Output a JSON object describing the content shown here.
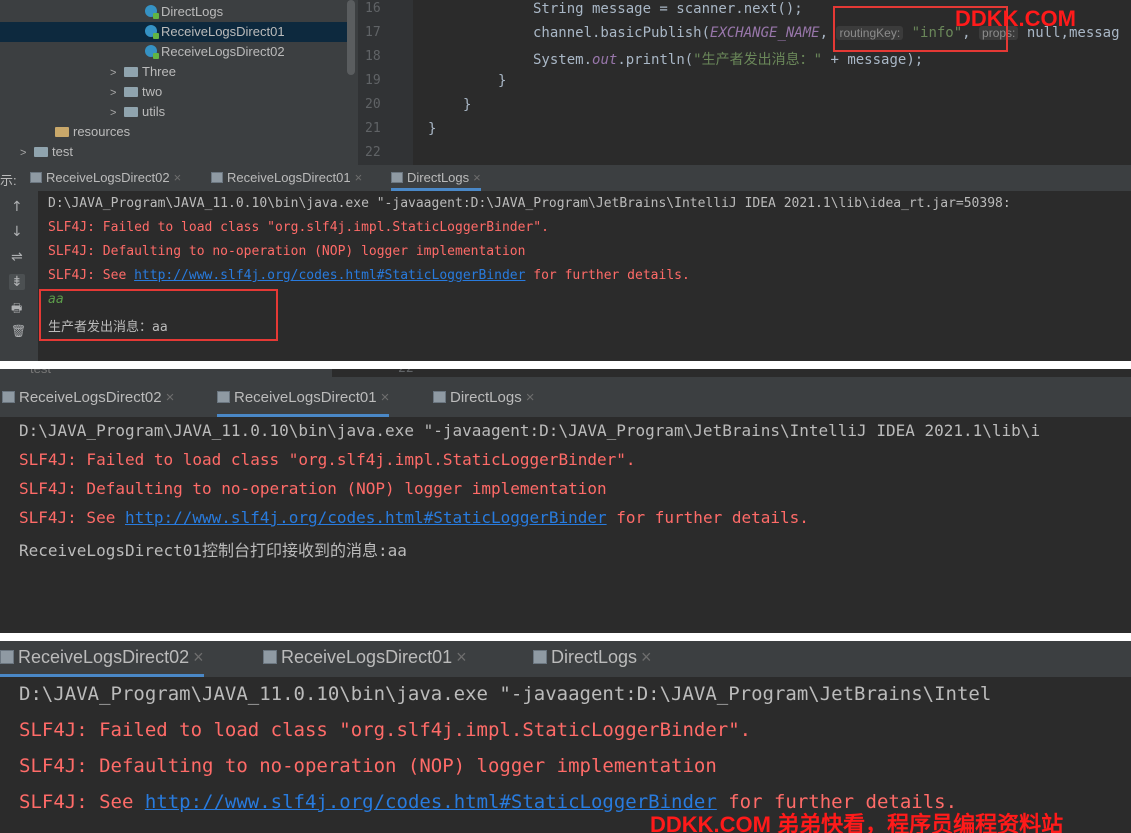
{
  "panel1": {
    "tree": {
      "items": [
        {
          "label": "DirectLogs"
        },
        {
          "label": "ReceiveLogsDirect01"
        },
        {
          "label": "ReceiveLogsDirect02"
        },
        {
          "label": "Three"
        },
        {
          "label": "two"
        },
        {
          "label": "utils"
        },
        {
          "label": "resources"
        },
        {
          "label": "test"
        }
      ]
    },
    "editor": {
      "line_numbers": [
        "16",
        "17",
        "18",
        "19",
        "20",
        "21",
        "22"
      ],
      "line16": "String message = scanner.next();",
      "line17_a": "channel.basicPublish(",
      "line17_const": "EXCHANGE_NAME",
      "line17_b": ", ",
      "line17_hint1": "routingKey:",
      "line17_str": "\"info\"",
      "line17_c": ", ",
      "line17_hint2": "props:",
      "line17_d": " null,messag",
      "line18_a": "System.",
      "line18_out": "out",
      "line18_b": ".println(",
      "line18_str": "\"生产者发出消息：\"",
      "line18_c": " + message);",
      "line19": "}",
      "line20": "}",
      "line21": "}"
    },
    "run_label": "示:",
    "tabs": [
      {
        "label": "ReceiveLogsDirect02"
      },
      {
        "label": "ReceiveLogsDirect01"
      },
      {
        "label": "DirectLogs"
      }
    ],
    "console": {
      "cmd": "D:\\JAVA_Program\\JAVA_11.0.10\\bin\\java.exe \"-javaagent:D:\\JAVA_Program\\JetBrains\\IntelliJ IDEA 2021.1\\lib\\idea_rt.jar=50398:",
      "err1": "SLF4J: Failed to load class \"org.slf4j.impl.StaticLoggerBinder\".",
      "err2": "SLF4J: Defaulting to no-operation (NOP) logger implementation",
      "err3_pre": "SLF4J: See ",
      "err3_link": "http://www.slf4j.org/codes.html#StaticLoggerBinder",
      "err3_post": " for further details.",
      "input": "aa",
      "output": "生产者发出消息：aa"
    },
    "tools": [
      "↑",
      "↓",
      "⇌",
      "⇟",
      "🖶",
      "🗑"
    ]
  },
  "panel2": {
    "strip_text": "test",
    "strip_num": "22",
    "tabs": [
      {
        "label": "ReceiveLogsDirect02"
      },
      {
        "label": "ReceiveLogsDirect01"
      },
      {
        "label": "DirectLogs"
      }
    ],
    "console": {
      "cmd": "D:\\JAVA_Program\\JAVA_11.0.10\\bin\\java.exe \"-javaagent:D:\\JAVA_Program\\JetBrains\\IntelliJ IDEA 2021.1\\lib\\i",
      "err1": "SLF4J: Failed to load class \"org.slf4j.impl.StaticLoggerBinder\".",
      "err2": "SLF4J: Defaulting to no-operation (NOP) logger implementation",
      "err3_pre": "SLF4J: See ",
      "err3_link": "http://www.slf4j.org/codes.html#StaticLoggerBinder",
      "err3_post": " for further details.",
      "output": "ReceiveLogsDirect01控制台打印接收到的消息:aa"
    }
  },
  "panel3": {
    "tabs": [
      {
        "label": "ReceiveLogsDirect02"
      },
      {
        "label": "ReceiveLogsDirect01"
      },
      {
        "label": "DirectLogs"
      }
    ],
    "console": {
      "cmd": "D:\\JAVA_Program\\JAVA_11.0.10\\bin\\java.exe \"-javaagent:D:\\JAVA_Program\\JetBrains\\Intel",
      "err1": "SLF4J: Failed to load class \"org.slf4j.impl.StaticLoggerBinder\".",
      "err2": "SLF4J: Defaulting to no-operation (NOP) logger implementation",
      "err3_pre": "SLF4J: See ",
      "err3_link": "http://www.slf4j.org/codes.html#StaticLoggerBinder",
      "err3_post": " for further details."
    }
  },
  "watermark": {
    "top": "DDKK.COM",
    "bottom": "DDKK.COM 弟弟快看，程序员编程资料站"
  },
  "colors": {
    "editor_bg": "#2b2b2b",
    "panel_bg": "#3c3f41",
    "error_red": "#ff6b68",
    "link_blue": "#287bde",
    "highlight_box": "#e53935",
    "watermark_red": "#ff1a1a"
  },
  "icons": {
    "class_icon": "java-class-icon",
    "folder_icon": "package-folder-icon",
    "tab_icon": "run-console-icon",
    "close_icon": "close-tab-icon"
  }
}
